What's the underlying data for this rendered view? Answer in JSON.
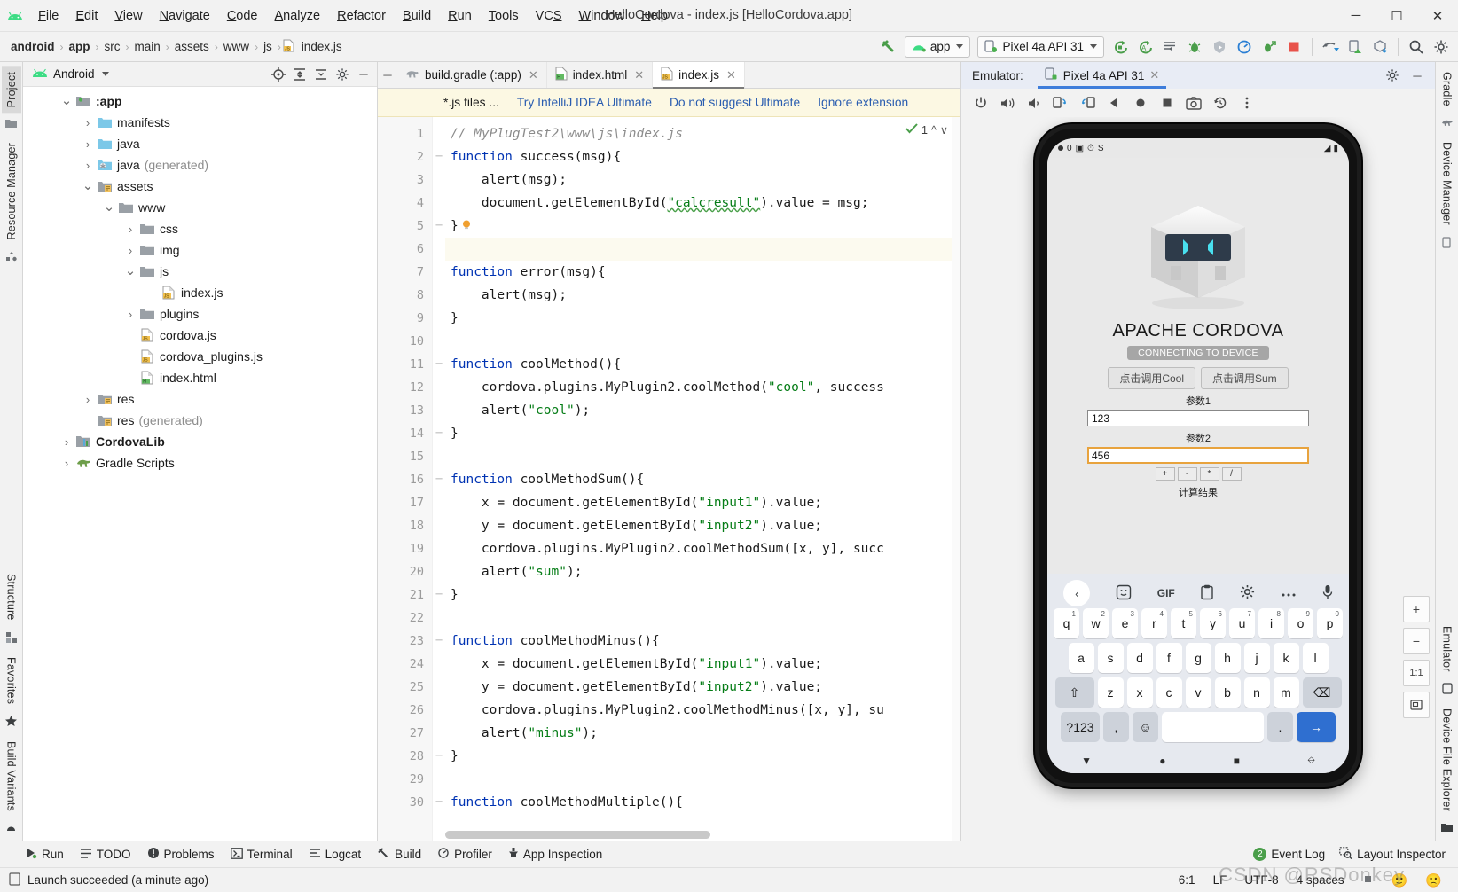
{
  "window": {
    "title": "HelloCordova - index.js [HelloCordova.app]",
    "minimize": "─",
    "maximize": "☐",
    "close": "✕"
  },
  "menubar": {
    "items": [
      {
        "label": "File",
        "mnemonic": "F"
      },
      {
        "label": "Edit",
        "mnemonic": "E"
      },
      {
        "label": "View",
        "mnemonic": "V"
      },
      {
        "label": "Navigate",
        "mnemonic": "N"
      },
      {
        "label": "Code",
        "mnemonic": "C"
      },
      {
        "label": "Analyze",
        "mnemonic": "A"
      },
      {
        "label": "Refactor",
        "mnemonic": "R"
      },
      {
        "label": "Build",
        "mnemonic": "B"
      },
      {
        "label": "Run",
        "mnemonic": "R"
      },
      {
        "label": "Tools",
        "mnemonic": "T"
      },
      {
        "label": "VCS",
        "mnemonic": "S"
      },
      {
        "label": "Window",
        "mnemonic": "W"
      },
      {
        "label": "Help",
        "mnemonic": "H"
      }
    ]
  },
  "breadcrumb": {
    "items": [
      "android",
      "app",
      "src",
      "main",
      "assets",
      "www",
      "js",
      "index.js"
    ],
    "separator": "›"
  },
  "toolbar": {
    "module_selector": "app",
    "device_selector": "Pixel 4a API 31",
    "buttons": [
      "make-project-icon",
      "run-icon",
      "apply-changes-icon",
      "run-config-icon",
      "debug-icon",
      "attach-debugger-icon",
      "profiler-icon",
      "debug-run-icon",
      "stop-icon",
      "sync-gradle-icon",
      "avd-manager-icon",
      "sdk-manager-icon",
      "search-icon",
      "settings-icon"
    ]
  },
  "left_strip": {
    "tabs": [
      "Project",
      "Resource Manager"
    ],
    "bottom_tabs": [
      "Structure",
      "Favorites",
      "Build Variants"
    ]
  },
  "right_strip": {
    "tabs": [
      "Gradle",
      "Device Manager",
      "Emulator",
      "Device File Explorer"
    ]
  },
  "project_panel": {
    "title": "Android",
    "actions": [
      "locate-icon",
      "expand-all-icon",
      "collapse-all-icon",
      "settings-icon",
      "hide-icon"
    ],
    "tree": [
      {
        "label": ":app",
        "indent": 0,
        "arrow": "down",
        "icon": "module-folder",
        "bold": true
      },
      {
        "label": "manifests",
        "indent": 1,
        "arrow": "right",
        "icon": "blue-folder"
      },
      {
        "label": "java",
        "indent": 1,
        "arrow": "right",
        "icon": "blue-folder"
      },
      {
        "label": "java",
        "suffix": "(generated)",
        "indent": 1,
        "arrow": "right",
        "icon": "gen-folder"
      },
      {
        "label": "assets",
        "indent": 1,
        "arrow": "down",
        "icon": "assets-folder"
      },
      {
        "label": "www",
        "indent": 2,
        "arrow": "down",
        "icon": "gray-folder"
      },
      {
        "label": "css",
        "indent": 3,
        "arrow": "right",
        "icon": "gray-folder"
      },
      {
        "label": "img",
        "indent": 3,
        "arrow": "right",
        "icon": "gray-folder"
      },
      {
        "label": "js",
        "indent": 3,
        "arrow": "down",
        "icon": "gray-folder"
      },
      {
        "label": "index.js",
        "indent": 4,
        "arrow": "none",
        "icon": "js-file"
      },
      {
        "label": "plugins",
        "indent": 3,
        "arrow": "right",
        "icon": "gray-folder"
      },
      {
        "label": "cordova.js",
        "indent": 3,
        "arrow": "none",
        "icon": "js-file"
      },
      {
        "label": "cordova_plugins.js",
        "indent": 3,
        "arrow": "none",
        "icon": "js-file"
      },
      {
        "label": "index.html",
        "indent": 3,
        "arrow": "none",
        "icon": "html-file"
      },
      {
        "label": "res",
        "indent": 1,
        "arrow": "right",
        "icon": "assets-folder"
      },
      {
        "label": "res",
        "suffix": "(generated)",
        "indent": 1,
        "arrow": "none",
        "icon": "assets-folder"
      },
      {
        "label": "CordovaLib",
        "indent": 0,
        "arrow": "right",
        "icon": "library-module",
        "bold": true
      },
      {
        "label": "Gradle Scripts",
        "indent": 0,
        "arrow": "right",
        "icon": "gradle-elephant",
        "bold": false
      }
    ]
  },
  "editor": {
    "tabs": [
      {
        "label": "build.gradle (:app)",
        "icon": "gradle-icon",
        "active": false
      },
      {
        "label": "index.html",
        "icon": "html-icon",
        "active": false
      },
      {
        "label": "index.js",
        "icon": "js-icon",
        "active": true
      }
    ],
    "notification": {
      "message": "*.js files ...",
      "link_primary": "Try IntelliJ IDEA Ultimate",
      "link_secondary": "Do not suggest Ultimate",
      "link_tertiary": "Ignore extension"
    },
    "inspection_count": "1",
    "lines": [
      {
        "n": 1,
        "fold": "",
        "html": "<span class='c'>// MyPlugTest2\\www\\js\\index.js</span>"
      },
      {
        "n": 2,
        "fold": "─",
        "html": "<span class='k'>function</span> success(msg){"
      },
      {
        "n": 3,
        "fold": "",
        "html": "    alert(msg);"
      },
      {
        "n": 4,
        "fold": "",
        "html": "    document.getElementById(<span class='s err-underline'>\"calcresult\"</span>).value = msg;"
      },
      {
        "n": 5,
        "fold": "─",
        "html": "}"
      },
      {
        "n": 6,
        "fold": "",
        "html": "",
        "current": true
      },
      {
        "n": 7,
        "fold": "",
        "html": "<span class='k'>function</span> error(msg){"
      },
      {
        "n": 8,
        "fold": "",
        "html": "    alert(msg);"
      },
      {
        "n": 9,
        "fold": "",
        "html": "}"
      },
      {
        "n": 10,
        "fold": "",
        "html": ""
      },
      {
        "n": 11,
        "fold": "─",
        "html": "<span class='k'>function</span> coolMethod(){"
      },
      {
        "n": 12,
        "fold": "",
        "html": "    cordova.plugins.MyPlugin2.coolMethod(<span class='s'>\"cool\"</span>, success"
      },
      {
        "n": 13,
        "fold": "",
        "html": "    alert(<span class='s'>\"cool\"</span>);"
      },
      {
        "n": 14,
        "fold": "─",
        "html": "}"
      },
      {
        "n": 15,
        "fold": "",
        "html": ""
      },
      {
        "n": 16,
        "fold": "─",
        "html": "<span class='k'>function</span> coolMethodSum(){"
      },
      {
        "n": 17,
        "fold": "",
        "html": "    x = document.getElementById(<span class='s'>\"input1\"</span>).value;"
      },
      {
        "n": 18,
        "fold": "",
        "html": "    y = document.getElementById(<span class='s'>\"input2\"</span>).value;"
      },
      {
        "n": 19,
        "fold": "",
        "html": "    cordova.plugins.MyPlugin2.coolMethodSum([x, y], succ"
      },
      {
        "n": 20,
        "fold": "",
        "html": "    alert(<span class='s'>\"sum\"</span>);"
      },
      {
        "n": 21,
        "fold": "─",
        "html": "}"
      },
      {
        "n": 22,
        "fold": "",
        "html": ""
      },
      {
        "n": 23,
        "fold": "─",
        "html": "<span class='k'>function</span> coolMethodMinus(){"
      },
      {
        "n": 24,
        "fold": "",
        "html": "    x = document.getElementById(<span class='s'>\"input1\"</span>).value;"
      },
      {
        "n": 25,
        "fold": "",
        "html": "    y = document.getElementById(<span class='s'>\"input2\"</span>).value;"
      },
      {
        "n": 26,
        "fold": "",
        "html": "    cordova.plugins.MyPlugin2.coolMethodMinus([x, y], su"
      },
      {
        "n": 27,
        "fold": "",
        "html": "    alert(<span class='s'>\"minus\"</span>);"
      },
      {
        "n": 28,
        "fold": "─",
        "html": "}"
      },
      {
        "n": 29,
        "fold": "",
        "html": ""
      },
      {
        "n": 30,
        "fold": "─",
        "html": "<span class='k'>function</span> coolMethodMultiple(){"
      }
    ]
  },
  "emulator": {
    "label": "Emulator:",
    "tab": "Pixel 4a API 31",
    "toolbar_buttons": [
      "power-icon",
      "volume-up-icon",
      "volume-down-icon",
      "rotate-left-icon",
      "rotate-right-icon",
      "back-icon",
      "home-icon",
      "overview-icon",
      "screenshot-icon",
      "history-icon",
      "more-icon"
    ],
    "side_buttons": [
      "zoom-in-icon",
      "zoom-out-icon",
      "actual-size-label",
      "fit-screen-icon"
    ],
    "zoom_level": "1:1",
    "device": {
      "status_bar": {
        "time": "0",
        "icons": [
          "dot-icon",
          "notification-icon",
          "clock-icon",
          "s-icon"
        ],
        "right_icons": [
          "wifi-icon",
          "battery-icon"
        ]
      },
      "app": {
        "title": "APACHE CORDOVA",
        "status": "CONNECTING TO DEVICE",
        "buttons": [
          "点击调用Cool",
          "点击调用Sum"
        ],
        "field1_label": "参数1",
        "field1_value": "123",
        "field2_label": "参数2",
        "field2_value": "456",
        "operators": [
          "+",
          "-",
          "*",
          "/"
        ],
        "result_label": "计算结果"
      },
      "keyboard": {
        "toolbar": [
          "back-arrow-icon",
          "sticker-icon",
          "GIF",
          "clipboard-icon",
          "settings-icon",
          "more-icon",
          "mic-icon"
        ],
        "row1": [
          {
            "k": "q",
            "n": "1"
          },
          {
            "k": "w",
            "n": "2"
          },
          {
            "k": "e",
            "n": "3"
          },
          {
            "k": "r",
            "n": "4"
          },
          {
            "k": "t",
            "n": "5"
          },
          {
            "k": "y",
            "n": "6"
          },
          {
            "k": "u",
            "n": "7"
          },
          {
            "k": "i",
            "n": "8"
          },
          {
            "k": "o",
            "n": "9"
          },
          {
            "k": "p",
            "n": "0"
          }
        ],
        "row2": [
          "a",
          "s",
          "d",
          "f",
          "g",
          "h",
          "j",
          "k",
          "l"
        ],
        "row3": [
          "⇧",
          "z",
          "x",
          "c",
          "v",
          "b",
          "n",
          "m",
          "⌫"
        ],
        "row4": [
          "?123",
          ",",
          "☺",
          "",
          ".",
          "→"
        ]
      },
      "nav": [
        "back-triangle-icon",
        "home-circle-icon",
        "recents-square-icon",
        "keyboard-icon"
      ]
    }
  },
  "tool_windows": {
    "items": [
      {
        "label": "Run",
        "icon": "run-icon"
      },
      {
        "label": "TODO",
        "icon": "todo-icon"
      },
      {
        "label": "Problems",
        "icon": "problems-icon"
      },
      {
        "label": "Terminal",
        "icon": "terminal-icon"
      },
      {
        "label": "Logcat",
        "icon": "logcat-icon"
      },
      {
        "label": "Build",
        "icon": "build-hammer-icon"
      },
      {
        "label": "Profiler",
        "icon": "profiler-icon"
      },
      {
        "label": "App Inspection",
        "icon": "app-inspection-icon"
      }
    ],
    "right": [
      {
        "label": "Event Log",
        "badge": "2",
        "icon": "event-log-icon"
      },
      {
        "label": "Layout Inspector",
        "icon": "layout-inspector-icon"
      }
    ]
  },
  "status_bar": {
    "message": "Launch succeeded (a minute ago)",
    "caret": "6:1",
    "line_separator": "LF",
    "encoding": "UTF-8",
    "indent": "4 spaces",
    "watermark": "CSDN @RSDonkey"
  }
}
